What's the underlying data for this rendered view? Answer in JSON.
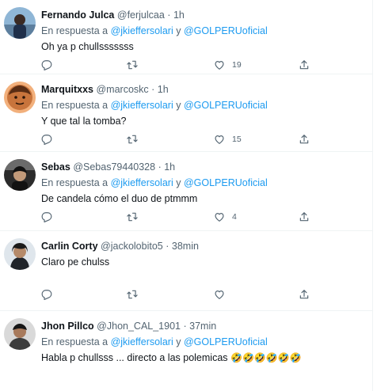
{
  "reply_prefix": "En respuesta a",
  "reply_join": "y",
  "colors": {
    "link": "#1d9bf0",
    "secondary": "#536471",
    "text": "#0f1419",
    "divider": "#eff3f4"
  },
  "icons": [
    "reply-icon",
    "retweet-icon",
    "like-icon",
    "share-icon"
  ],
  "tweets": [
    {
      "name": "Fernando Julca",
      "handle": "@ferjulcaa",
      "dot": "·",
      "time": "1h",
      "mention1": "@jkieffersolari",
      "mention2": "@GOLPERUoficial",
      "text": "Oh ya p chullsssssss",
      "likes": "19",
      "retweets": "",
      "replies": ""
    },
    {
      "name": "Marquitxxs",
      "handle": "@marcoskc",
      "dot": "·",
      "time": "1h",
      "mention1": "@jkieffersolari",
      "mention2": "@GOLPERUoficial",
      "text": "Y que tal la tomba?",
      "likes": "15",
      "retweets": "",
      "replies": ""
    },
    {
      "name": "Sebas",
      "handle": "@Sebas79440328",
      "dot": "·",
      "time": "1h",
      "mention1": "@jkieffersolari",
      "mention2": "@GOLPERUoficial",
      "text": "De candela cómo el duo de ptmmm",
      "likes": "4",
      "retweets": "",
      "replies": ""
    },
    {
      "name": "Carlin Corty",
      "handle": "@jackolobito5",
      "dot": "·",
      "time": "38min",
      "text": "Claro pe chulss",
      "likes": "",
      "retweets": "",
      "replies": ""
    },
    {
      "name": "Jhon Pillco",
      "handle": "@Jhon_CAL_1901",
      "dot": "·",
      "time": "37min",
      "mention1": "@jkieffersolari",
      "mention2": "@GOLPERUoficial",
      "text": "Habla p chullsss ... directo a las polemicas",
      "emoji": "🤣🤣🤣🤣🤣🤣",
      "likes": "",
      "retweets": "",
      "replies": ""
    }
  ]
}
